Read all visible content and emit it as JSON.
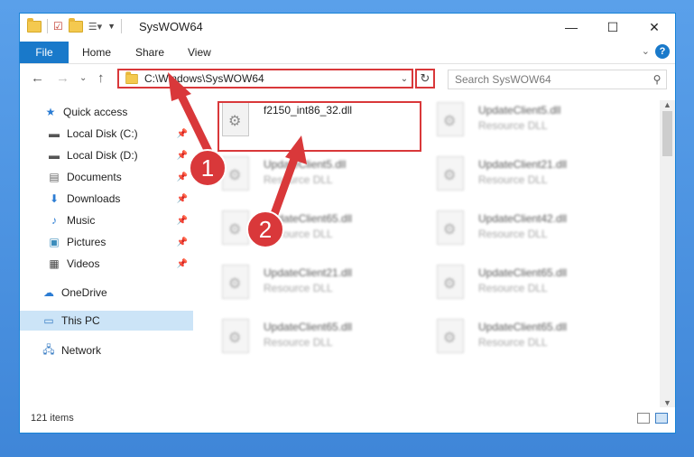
{
  "window": {
    "title": "SysWOW64"
  },
  "ribbon": {
    "file": "File",
    "tabs": [
      "Home",
      "Share",
      "View"
    ],
    "help": "?"
  },
  "address": {
    "path": "C:\\Windows\\SysWOW64"
  },
  "search": {
    "placeholder": "Search SysWOW64"
  },
  "sidebar": {
    "items": [
      {
        "label": "Quick access",
        "icon": "star-icon"
      },
      {
        "label": "Local Disk (C:)",
        "icon": "drive-icon",
        "pinned": true
      },
      {
        "label": "Local Disk (D:)",
        "icon": "drive-icon",
        "pinned": true
      },
      {
        "label": "Documents",
        "icon": "documents-icon",
        "pinned": true
      },
      {
        "label": "Downloads",
        "icon": "download-icon",
        "pinned": true
      },
      {
        "label": "Music",
        "icon": "music-icon",
        "pinned": true
      },
      {
        "label": "Pictures",
        "icon": "pictures-icon",
        "pinned": true
      },
      {
        "label": "Videos",
        "icon": "video-icon",
        "pinned": true
      },
      {
        "label": "OneDrive",
        "icon": "cloud-icon"
      },
      {
        "label": "This PC",
        "icon": "pc-icon",
        "selected": true
      },
      {
        "label": "Network",
        "icon": "network-icon"
      }
    ]
  },
  "files": [
    {
      "name": "f2150_int86_32.dll",
      "type": ""
    },
    {
      "name": "UpdateClient5.dll",
      "type": "Resource DLL"
    },
    {
      "name": "UpdateClient5.dll",
      "type": "Resource DLL"
    },
    {
      "name": "UpdateClient21.dll",
      "type": "Resource DLL"
    },
    {
      "name": "UpdateClient65.dll",
      "type": "Resource DLL"
    },
    {
      "name": "UpdateClient42.dll",
      "type": "Resource DLL"
    },
    {
      "name": "UpdateClient21.dll",
      "type": "Resource DLL"
    },
    {
      "name": "UpdateClient65.dll",
      "type": "Resource DLL"
    },
    {
      "name": "UpdateClient65.dll",
      "type": "Resource DLL"
    },
    {
      "name": "UpdateClient65.dll",
      "type": "Resource DLL"
    }
  ],
  "status": {
    "count": "121 items"
  },
  "annotations": {
    "step1": "1",
    "step2": "2"
  },
  "colors": {
    "accent": "#1979ca",
    "highlight": "#d9383a",
    "selection": "#cce4f7"
  }
}
